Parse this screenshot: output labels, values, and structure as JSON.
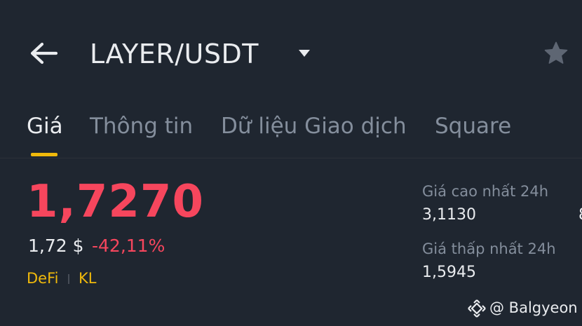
{
  "header": {
    "back_icon": "arrow-left-icon",
    "pair": "LAYER/USDT",
    "dropdown_icon": "caret-down-icon",
    "favorite_icon": "star-icon"
  },
  "tabs": [
    {
      "label": "Giá",
      "active": true
    },
    {
      "label": "Thông tin",
      "active": false
    },
    {
      "label": "Dữ liệu Giao dịch",
      "active": false
    },
    {
      "label": "Square",
      "active": false
    }
  ],
  "price": {
    "last": "1,7270",
    "fiat": "1,72 $",
    "change": "-42,11%",
    "tags": [
      "DeFi",
      "KL"
    ]
  },
  "stats": [
    {
      "label": "Giá cao nhất 24h",
      "value": "3,1130"
    },
    {
      "label": "Giá thấp nhất 24h",
      "value": "1,5945"
    }
  ],
  "clipped_text": "8",
  "watermark": {
    "icon": "binance-logo-icon",
    "text": "@ Balgyeon"
  },
  "colors": {
    "background": "#1f2630",
    "accent": "#f0b90b",
    "down": "#f6465d",
    "text_primary": "#eaecef",
    "text_secondary": "#848e9c"
  }
}
